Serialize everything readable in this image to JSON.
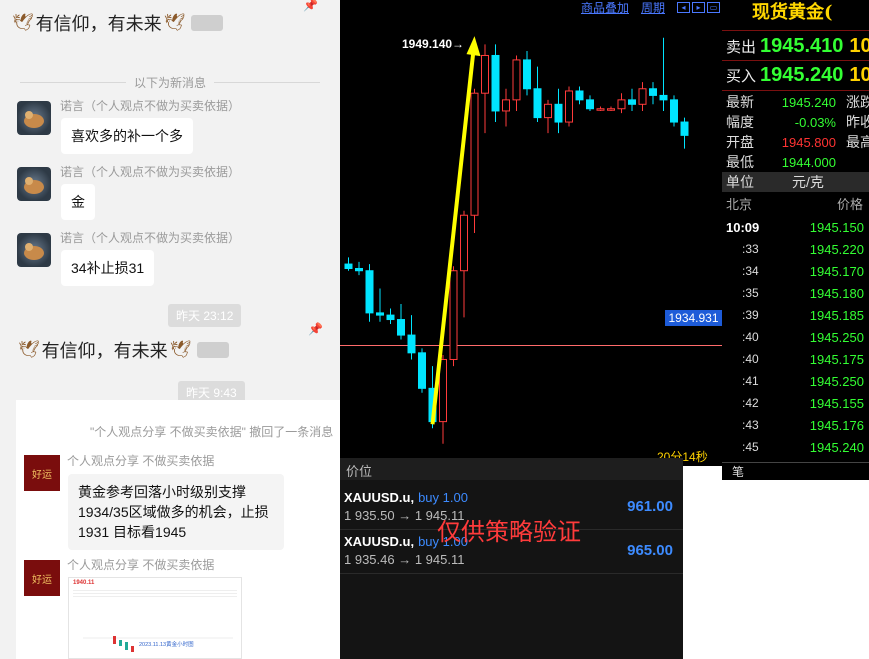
{
  "chat": {
    "pinned_1": "有信仰，有未来",
    "divider_new": "以下为新消息",
    "messages": [
      {
        "sender": "诺言（个人观点不做为买卖依据）",
        "text": "喜欢多的补一个多"
      },
      {
        "sender": "诺言（个人观点不做为买卖依据）",
        "text": "金"
      },
      {
        "sender": "诺言（个人观点不做为买卖依据）",
        "text": "34补止损31"
      }
    ],
    "time_1": "昨天 23:12",
    "pinned_2": "有信仰，有未来",
    "time_2": "昨天 9:43",
    "recall_notice": "\"个人观点分享 不做买卖依据\" 撤回了一条消息",
    "analyst_name": "个人观点分享 不做买卖依据",
    "analyst_text": "黄金参考回落小时级别支撑1934/35区域做多的机会，止损1931 目标看1945",
    "analyst_name_2": "个人观点分享 不做买卖依据",
    "avatar_text": "好运",
    "mini_price": "1940.11",
    "mini_caption": "2023.11.13黄金小时图"
  },
  "chart": {
    "links": [
      "商品叠加",
      "周期"
    ],
    "high_label": "1949.140→",
    "current_price_tag": "1934.931",
    "countdown": "20分14秒"
  },
  "chart_data": {
    "type": "candlestick",
    "candles": [
      [
        1938.6,
        1938.9,
        1938.3,
        1938.4
      ],
      [
        1938.4,
        1938.7,
        1938.1,
        1938.3
      ],
      [
        1938.3,
        1938.6,
        1936.0,
        1936.4
      ],
      [
        1936.4,
        1937.5,
        1936.0,
        1936.3
      ],
      [
        1936.3,
        1936.6,
        1935.9,
        1936.1
      ],
      [
        1936.1,
        1936.8,
        1935.2,
        1935.4
      ],
      [
        1935.4,
        1936.3,
        1934.3,
        1934.6
      ],
      [
        1934.6,
        1934.8,
        1932.8,
        1933.0
      ],
      [
        1933.0,
        1934.0,
        1931.2,
        1931.5
      ],
      [
        1931.5,
        1934.5,
        1930.5,
        1934.3
      ],
      [
        1934.3,
        1938.5,
        1934.0,
        1938.3
      ],
      [
        1938.3,
        1941.0,
        1936.2,
        1940.8
      ],
      [
        1940.8,
        1946.5,
        1940.0,
        1946.3
      ],
      [
        1946.3,
        1948.5,
        1944.5,
        1948.0
      ],
      [
        1948.0,
        1948.5,
        1945.0,
        1945.5
      ],
      [
        1945.5,
        1946.5,
        1944.8,
        1946.0
      ],
      [
        1946.0,
        1948.0,
        1945.5,
        1947.8
      ],
      [
        1947.8,
        1948.2,
        1946.2,
        1946.5
      ],
      [
        1946.5,
        1947.5,
        1945.0,
        1945.2
      ],
      [
        1945.2,
        1946.0,
        1944.5,
        1945.8
      ],
      [
        1945.8,
        1946.5,
        1944.5,
        1945.0
      ],
      [
        1945.0,
        1946.6,
        1944.8,
        1946.4
      ],
      [
        1946.4,
        1946.6,
        1945.8,
        1946.0
      ],
      [
        1946.0,
        1946.2,
        1945.5,
        1945.6
      ],
      [
        1945.6,
        1945.7,
        1945.5,
        1945.6
      ],
      [
        1945.6,
        1945.7,
        1945.5,
        1945.6
      ],
      [
        1945.6,
        1946.3,
        1945.4,
        1946.0
      ],
      [
        1946.0,
        1946.5,
        1945.5,
        1945.8
      ],
      [
        1945.8,
        1946.8,
        1945.5,
        1946.5
      ],
      [
        1946.5,
        1946.8,
        1945.8,
        1946.2
      ],
      [
        1946.2,
        1948.8,
        1945.5,
        1946.0
      ],
      [
        1946.0,
        1946.2,
        1944.8,
        1945.0
      ],
      [
        1945.0,
        1945.2,
        1943.8,
        1944.4
      ]
    ],
    "high_marker": 1949.14,
    "current_price": 1934.931,
    "ylim": [
      1929.5,
      1950.5
    ],
    "colors": {
      "up": "#ff3b3b",
      "down": "#00e5ff"
    }
  },
  "quote": {
    "title": "现货黄金(",
    "sell_label": "卖出",
    "sell_value": "1945.410",
    "sell_extra": "10",
    "buy_label": "买入",
    "buy_value": "1945.240",
    "buy_extra": "10",
    "stats": [
      {
        "label": "最新",
        "value": "1945.240",
        "right": "涨跌"
      },
      {
        "label": "幅度",
        "value": "-0.03%",
        "right": "昨收"
      },
      {
        "label": "开盘",
        "value": "1945.800",
        "right": "最高"
      },
      {
        "label": "最低",
        "value": "1944.000",
        "right": ""
      }
    ],
    "unit_label": "单位",
    "unit_value": "元/克",
    "col_time": "北京",
    "col_price": "价格",
    "ticks": [
      {
        "time": "10:09",
        "price": "1945.150"
      },
      {
        "time": ":33",
        "price": "1945.220"
      },
      {
        "time": ":34",
        "price": "1945.170"
      },
      {
        "time": ":35",
        "price": "1945.180"
      },
      {
        "time": ":39",
        "price": "1945.185"
      },
      {
        "time": ":40",
        "price": "1945.250"
      },
      {
        "time": ":40",
        "price": "1945.175"
      },
      {
        "time": ":41",
        "price": "1945.250"
      },
      {
        "time": ":42",
        "price": "1945.155"
      },
      {
        "time": ":43",
        "price": "1945.176"
      },
      {
        "time": ":45",
        "price": "1945.240"
      }
    ],
    "footer": "笔"
  },
  "positions": {
    "header": "价位",
    "rows": [
      {
        "symbol": "XAUUSD.u,",
        "side": "buy 1.00",
        "prices": "1 935.50 → 1 945.11",
        "profit": "961.00"
      },
      {
        "symbol": "XAUUSD.u,",
        "side": "buy 1.00",
        "prices": "1 935.46 → 1 945.11",
        "profit": "965.00"
      }
    ],
    "watermark": "仅供策略验证"
  }
}
